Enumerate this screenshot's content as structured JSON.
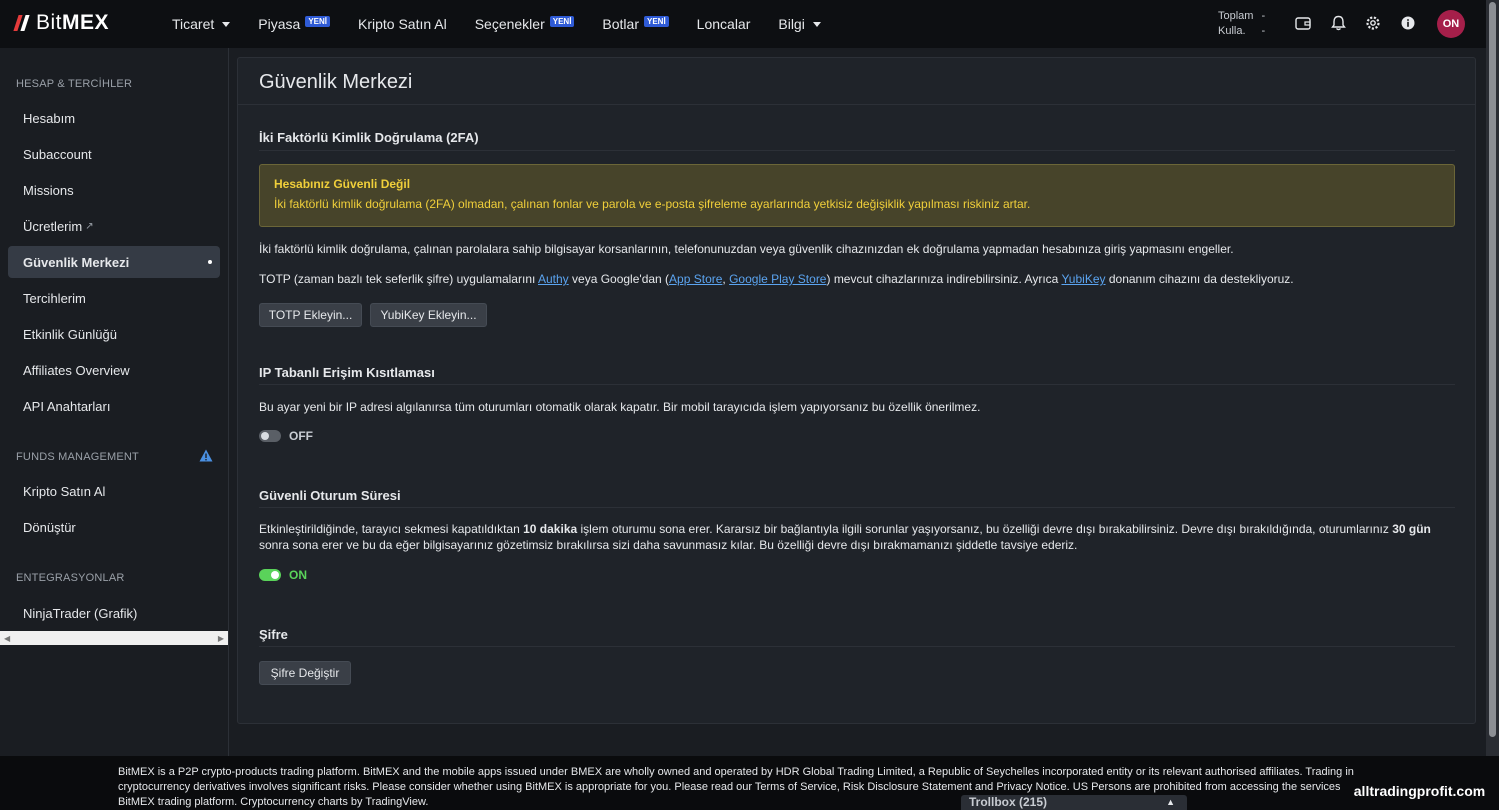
{
  "brand": {
    "name_light": "Bit",
    "name_bold": "MEX"
  },
  "nav": {
    "items": [
      {
        "label": "Ticaret",
        "caret": true,
        "badge": ""
      },
      {
        "label": "Piyasa",
        "caret": false,
        "badge": "YENİ"
      },
      {
        "label": "Kripto Satın Al",
        "caret": false,
        "badge": ""
      },
      {
        "label": "Seçenekler",
        "caret": false,
        "badge": "YENİ"
      },
      {
        "label": "Botlar",
        "caret": false,
        "badge": "YENİ"
      },
      {
        "label": "Loncalar",
        "caret": false,
        "badge": ""
      },
      {
        "label": "Bilgi",
        "caret": true,
        "badge": ""
      }
    ],
    "balance_total_label": "Toplam",
    "balance_total_value": "-",
    "balance_avail_label": "Kulla.",
    "balance_avail_value": "-",
    "icons": [
      "wallet-icon",
      "bell-icon",
      "gear-icon",
      "info-icon"
    ],
    "avatar_initials": "ON",
    "avatar_color": "#a51f4a"
  },
  "sidebar": {
    "section1": "HESAP & TERCİHLER",
    "items1": [
      "Hesabım",
      "Subaccount",
      "Missions",
      "Ücretlerim",
      "Güvenlik Merkezi",
      "Tercihlerim",
      "Etkinlik Günlüğü",
      "Affiliates Overview",
      "API Anahtarları"
    ],
    "active": "Güvenlik Merkezi",
    "section2": "FUNDS MANAGEMENT",
    "items2": [
      "Kripto Satın Al",
      "Dönüştür"
    ],
    "section3": "ENTEGRASYONLAR",
    "items3": [
      "NinjaTrader (Grafik)"
    ]
  },
  "main": {
    "title": "Güvenlik Merkezi",
    "twofa": {
      "title": "İki Faktörlü Kimlik Doğrulama (2FA)",
      "alert_title": "Hesabınız Güvenli Değil",
      "alert_text": "İki faktörlü kimlik doğrulama (2FA) olmadan, çalınan fonlar ve parola ve e-posta şifreleme ayarlarında yetkisiz değişiklik yapılması riskiniz artar.",
      "desc": "İki faktörlü kimlik doğrulama, çalınan parolalara sahip bilgisayar korsanlarının, telefonunuzdan veya güvenlik cihazınızdan ek doğrulama yapmadan hesabınıza giriş yapmasını engeller.",
      "totp_p1": "TOTP (zaman bazlı tek seferlik şifre) uygulamalarını ",
      "link_authy": "Authy",
      "totp_p2": " veya Google'dan (",
      "link_appstore": "App Store",
      "totp_p3": ", ",
      "link_play": "Google Play Store",
      "totp_p4": ") mevcut cihazlarınıza indirebilirsiniz. Ayrıca ",
      "link_yubikey": "YubiKey",
      "totp_p5": " donanım cihazını da destekliyoruz.",
      "btn_totp": "TOTP Ekleyin...",
      "btn_yubikey": "YubiKey Ekleyin..."
    },
    "ip": {
      "title": "IP Tabanlı Erişim Kısıtlaması",
      "desc": "Bu ayar yeni bir IP adresi algılanırsa tüm oturumları otomatik olarak kapatır. Bir mobil tarayıcıda işlem yapıyorsanız bu özellik önerilmez.",
      "state": "OFF"
    },
    "session": {
      "title": "Güvenli Oturum Süresi",
      "p1": "Etkinleştirildiğinde, tarayıcı sekmesi kapatıldıktan ",
      "b1": "10 dakika",
      "p2": " işlem oturumu sona erer. Kararsız bir bağlantıyla ilgili sorunlar yaşıyorsanız, bu özelliği devre dışı bırakabilirsiniz. Devre dışı bırakıldığında, oturumlarınız ",
      "b2": "30 gün",
      "p3": " sonra sona erer ve bu da eğer bilgisayarınız gözetimsiz bırakılırsa sizi daha savunmasız kılar. Bu özelliği devre dışı bırakmamanızı şiddetle tavsiye ederiz.",
      "state": "ON"
    },
    "password": {
      "title": "Şifre",
      "btn": "Şifre Değiştir"
    }
  },
  "footer": {
    "text": "BitMEX is a P2P crypto-products trading platform. BitMEX and the mobile apps issued under BMEX are wholly owned and operated by HDR Global Trading Limited, a Republic of Seychelles incorporated entity or its relevant authorised affiliates. Trading in cryptocurrency derivatives involves significant risks. Please consider whether using BitMEX is appropriate for you. Please read our Terms of Service, Risk Disclosure Statement and Privacy Notice. US Persons are prohibited from accessing the services of the BitMEX trading platform. Cryptocurrency charts by TradingView.",
    "trollbox": "Trollbox (215)",
    "watermark": "alltradingprofit.com"
  },
  "colors": {
    "accent_link": "#5ba4f0",
    "warning": "#f0cf3a",
    "toggle_on": "#5ad35a",
    "badge": "#2f5bd6"
  }
}
